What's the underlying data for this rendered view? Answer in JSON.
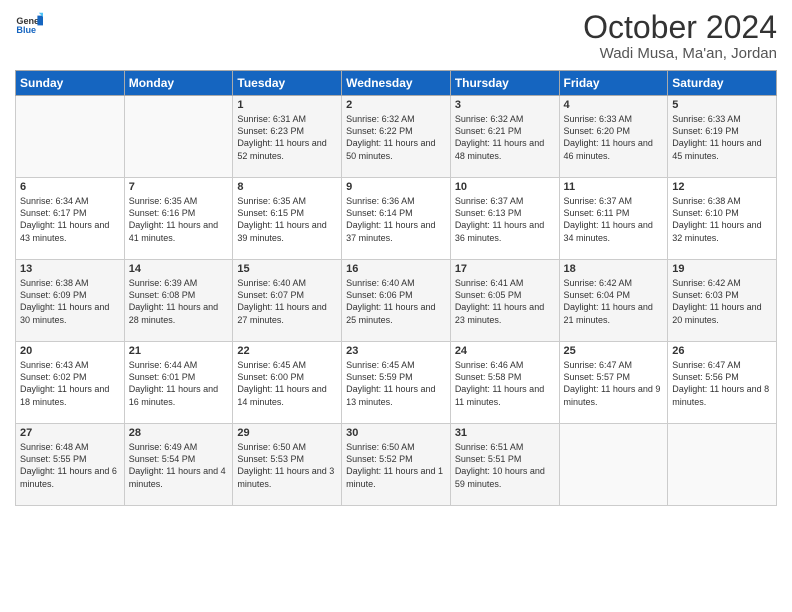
{
  "header": {
    "logo_general": "General",
    "logo_blue": "Blue",
    "month": "October 2024",
    "location": "Wadi Musa, Ma'an, Jordan"
  },
  "weekdays": [
    "Sunday",
    "Monday",
    "Tuesday",
    "Wednesday",
    "Thursday",
    "Friday",
    "Saturday"
  ],
  "weeks": [
    [
      {
        "day": "",
        "content": ""
      },
      {
        "day": "",
        "content": ""
      },
      {
        "day": "1",
        "content": "Sunrise: 6:31 AM\nSunset: 6:23 PM\nDaylight: 11 hours and 52 minutes."
      },
      {
        "day": "2",
        "content": "Sunrise: 6:32 AM\nSunset: 6:22 PM\nDaylight: 11 hours and 50 minutes."
      },
      {
        "day": "3",
        "content": "Sunrise: 6:32 AM\nSunset: 6:21 PM\nDaylight: 11 hours and 48 minutes."
      },
      {
        "day": "4",
        "content": "Sunrise: 6:33 AM\nSunset: 6:20 PM\nDaylight: 11 hours and 46 minutes."
      },
      {
        "day": "5",
        "content": "Sunrise: 6:33 AM\nSunset: 6:19 PM\nDaylight: 11 hours and 45 minutes."
      }
    ],
    [
      {
        "day": "6",
        "content": "Sunrise: 6:34 AM\nSunset: 6:17 PM\nDaylight: 11 hours and 43 minutes."
      },
      {
        "day": "7",
        "content": "Sunrise: 6:35 AM\nSunset: 6:16 PM\nDaylight: 11 hours and 41 minutes."
      },
      {
        "day": "8",
        "content": "Sunrise: 6:35 AM\nSunset: 6:15 PM\nDaylight: 11 hours and 39 minutes."
      },
      {
        "day": "9",
        "content": "Sunrise: 6:36 AM\nSunset: 6:14 PM\nDaylight: 11 hours and 37 minutes."
      },
      {
        "day": "10",
        "content": "Sunrise: 6:37 AM\nSunset: 6:13 PM\nDaylight: 11 hours and 36 minutes."
      },
      {
        "day": "11",
        "content": "Sunrise: 6:37 AM\nSunset: 6:11 PM\nDaylight: 11 hours and 34 minutes."
      },
      {
        "day": "12",
        "content": "Sunrise: 6:38 AM\nSunset: 6:10 PM\nDaylight: 11 hours and 32 minutes."
      }
    ],
    [
      {
        "day": "13",
        "content": "Sunrise: 6:38 AM\nSunset: 6:09 PM\nDaylight: 11 hours and 30 minutes."
      },
      {
        "day": "14",
        "content": "Sunrise: 6:39 AM\nSunset: 6:08 PM\nDaylight: 11 hours and 28 minutes."
      },
      {
        "day": "15",
        "content": "Sunrise: 6:40 AM\nSunset: 6:07 PM\nDaylight: 11 hours and 27 minutes."
      },
      {
        "day": "16",
        "content": "Sunrise: 6:40 AM\nSunset: 6:06 PM\nDaylight: 11 hours and 25 minutes."
      },
      {
        "day": "17",
        "content": "Sunrise: 6:41 AM\nSunset: 6:05 PM\nDaylight: 11 hours and 23 minutes."
      },
      {
        "day": "18",
        "content": "Sunrise: 6:42 AM\nSunset: 6:04 PM\nDaylight: 11 hours and 21 minutes."
      },
      {
        "day": "19",
        "content": "Sunrise: 6:42 AM\nSunset: 6:03 PM\nDaylight: 11 hours and 20 minutes."
      }
    ],
    [
      {
        "day": "20",
        "content": "Sunrise: 6:43 AM\nSunset: 6:02 PM\nDaylight: 11 hours and 18 minutes."
      },
      {
        "day": "21",
        "content": "Sunrise: 6:44 AM\nSunset: 6:01 PM\nDaylight: 11 hours and 16 minutes."
      },
      {
        "day": "22",
        "content": "Sunrise: 6:45 AM\nSunset: 6:00 PM\nDaylight: 11 hours and 14 minutes."
      },
      {
        "day": "23",
        "content": "Sunrise: 6:45 AM\nSunset: 5:59 PM\nDaylight: 11 hours and 13 minutes."
      },
      {
        "day": "24",
        "content": "Sunrise: 6:46 AM\nSunset: 5:58 PM\nDaylight: 11 hours and 11 minutes."
      },
      {
        "day": "25",
        "content": "Sunrise: 6:47 AM\nSunset: 5:57 PM\nDaylight: 11 hours and 9 minutes."
      },
      {
        "day": "26",
        "content": "Sunrise: 6:47 AM\nSunset: 5:56 PM\nDaylight: 11 hours and 8 minutes."
      }
    ],
    [
      {
        "day": "27",
        "content": "Sunrise: 6:48 AM\nSunset: 5:55 PM\nDaylight: 11 hours and 6 minutes."
      },
      {
        "day": "28",
        "content": "Sunrise: 6:49 AM\nSunset: 5:54 PM\nDaylight: 11 hours and 4 minutes."
      },
      {
        "day": "29",
        "content": "Sunrise: 6:50 AM\nSunset: 5:53 PM\nDaylight: 11 hours and 3 minutes."
      },
      {
        "day": "30",
        "content": "Sunrise: 6:50 AM\nSunset: 5:52 PM\nDaylight: 11 hours and 1 minute."
      },
      {
        "day": "31",
        "content": "Sunrise: 6:51 AM\nSunset: 5:51 PM\nDaylight: 10 hours and 59 minutes."
      },
      {
        "day": "",
        "content": ""
      },
      {
        "day": "",
        "content": ""
      }
    ]
  ]
}
